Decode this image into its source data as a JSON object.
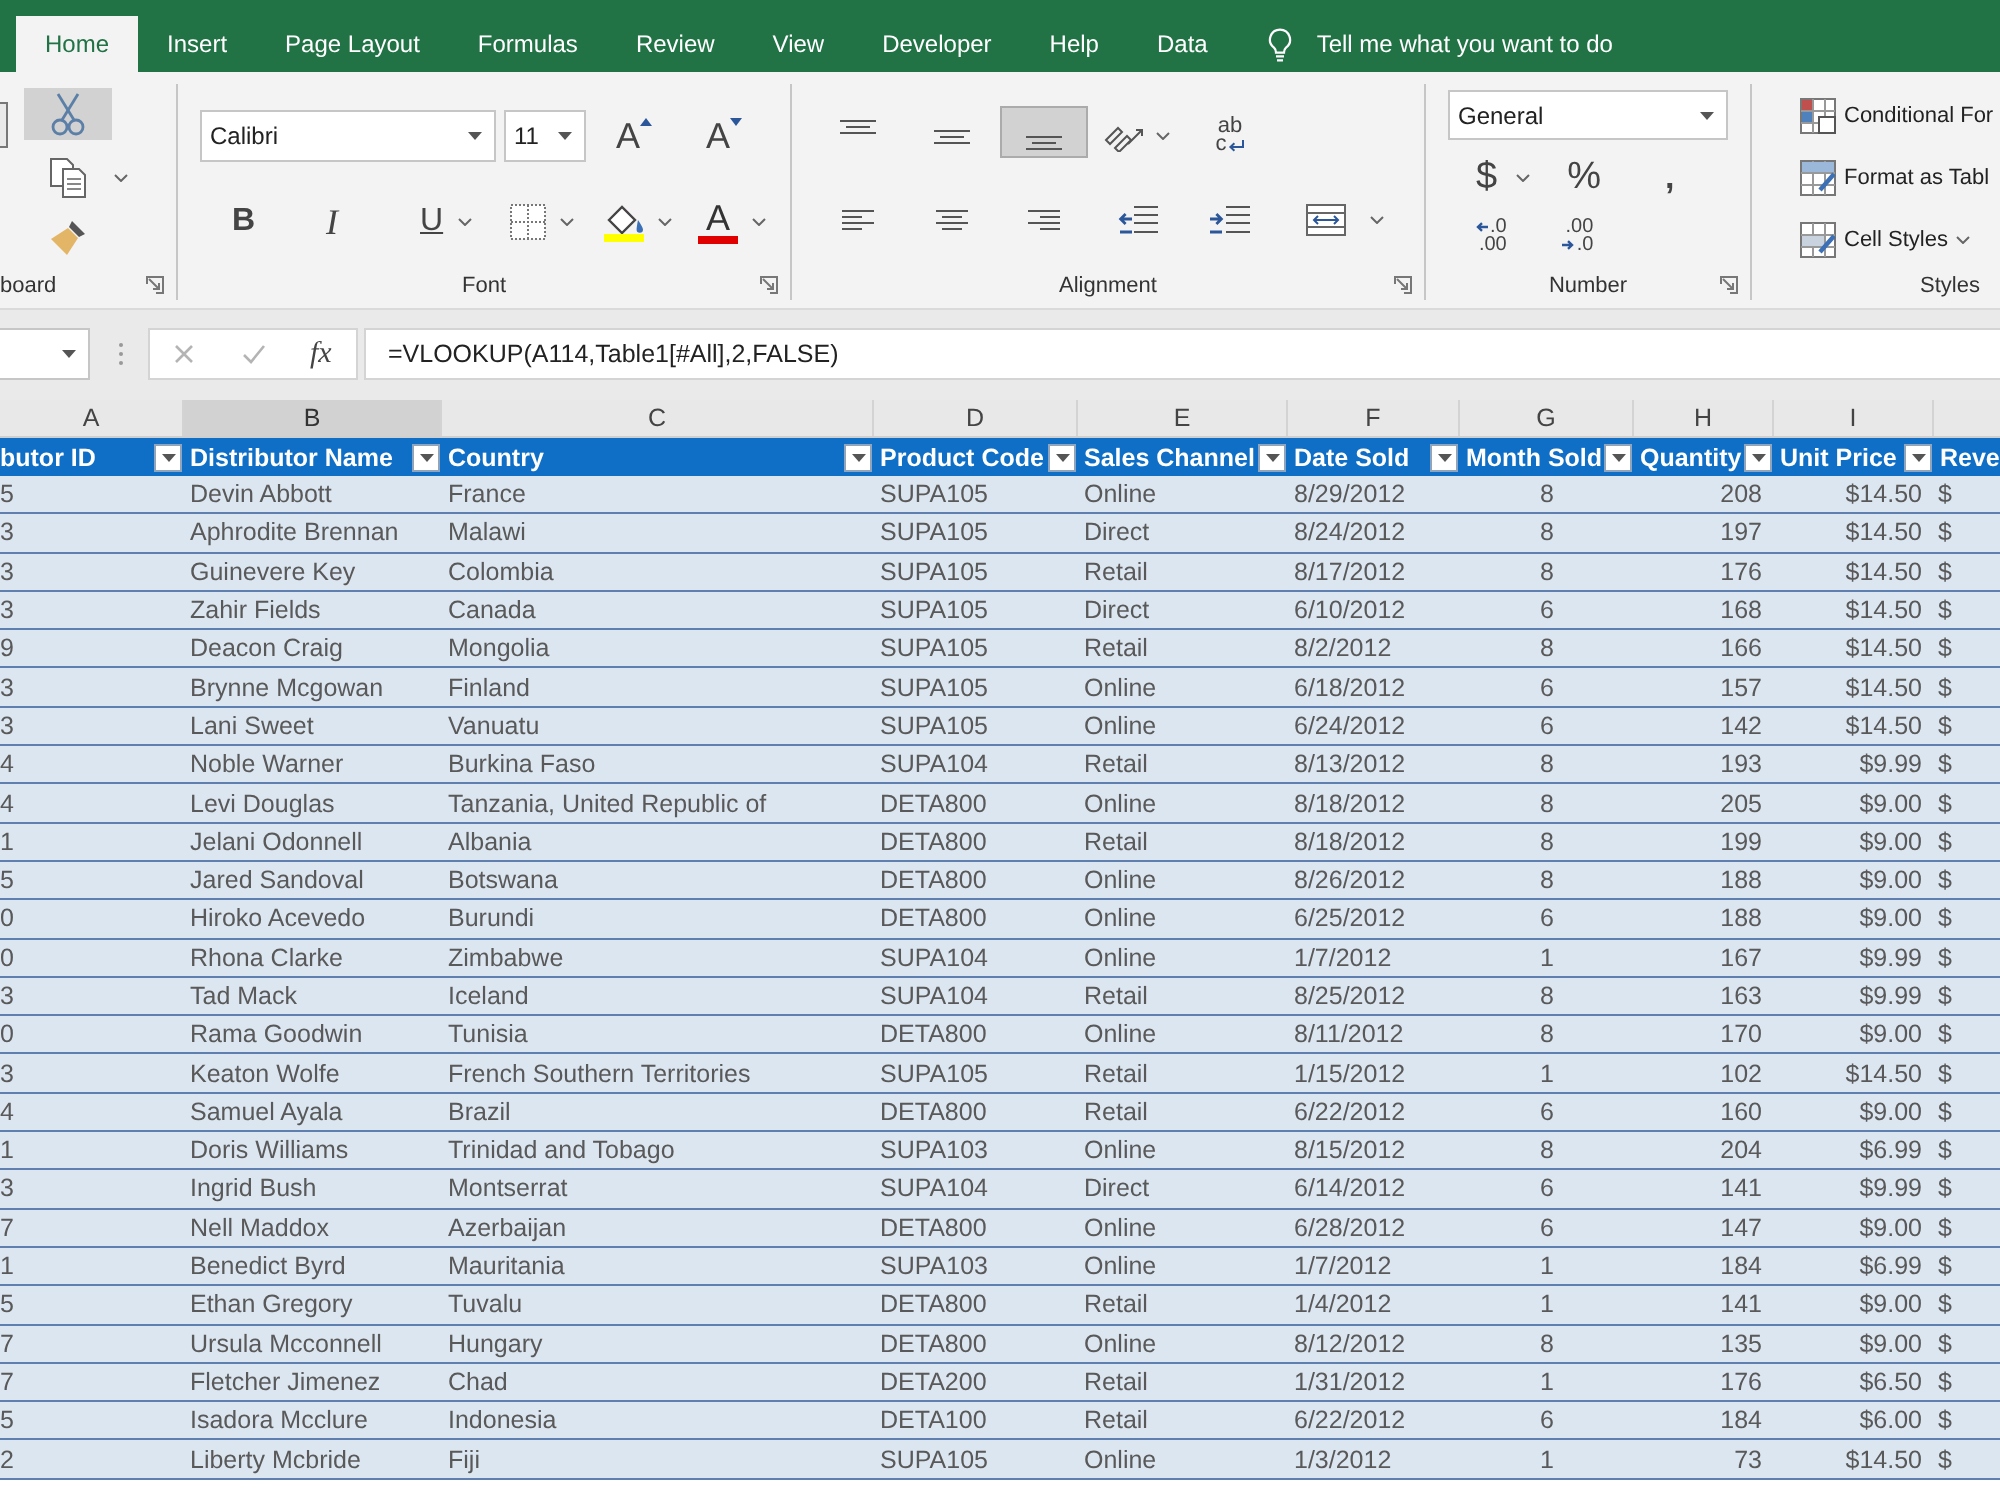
{
  "ribbon_tabs": [
    {
      "label": "Home",
      "selected": true
    },
    {
      "label": "Insert",
      "selected": false
    },
    {
      "label": "Page Layout",
      "selected": false
    },
    {
      "label": "Formulas",
      "selected": false
    },
    {
      "label": "Review",
      "selected": false
    },
    {
      "label": "View",
      "selected": false
    },
    {
      "label": "Developer",
      "selected": false
    },
    {
      "label": "Help",
      "selected": false
    },
    {
      "label": "Data",
      "selected": false
    }
  ],
  "tell_me": {
    "placeholder": "Tell me what you want to do"
  },
  "clipboard": {
    "label": "board",
    "launcher": true,
    "tools": [
      {
        "kind": "cut",
        "selected": true,
        "menu": false
      },
      {
        "kind": "copy",
        "selected": false,
        "menu": true
      },
      {
        "kind": "painter",
        "selected": false,
        "menu": false
      }
    ]
  },
  "font": {
    "label": "Font",
    "launcher": true,
    "font_name": "Calibri",
    "font_size": "11",
    "size_tools": [
      {
        "kind": "grow",
        "label": "A"
      },
      {
        "kind": "shrink",
        "label": "A"
      }
    ],
    "tools": [
      {
        "kind": "bold",
        "label": "B",
        "menu": false
      },
      {
        "kind": "italic",
        "label": "I",
        "menu": false
      },
      {
        "kind": "underline",
        "label": "U",
        "menu": true
      },
      {
        "kind": "borders",
        "menu": true
      },
      {
        "kind": "fill",
        "menu": true,
        "color": "#ffff00"
      },
      {
        "kind": "font-color",
        "label": "A",
        "menu": true,
        "color": "#e00000"
      }
    ]
  },
  "alignment": {
    "label": "Alignment",
    "launcher": true,
    "top_tools": [
      {
        "kind": "top",
        "selected": false,
        "menu": false
      },
      {
        "kind": "middle",
        "selected": false,
        "menu": false
      },
      {
        "kind": "bottom",
        "selected": true,
        "menu": false
      },
      {
        "kind": "orientation",
        "selected": false,
        "menu": true
      },
      {
        "kind": "wrap",
        "selected": false,
        "menu": false,
        "label": "ab",
        "sub_label": "c"
      }
    ],
    "bottom_tools": [
      {
        "kind": "left",
        "selected": false,
        "menu": false
      },
      {
        "kind": "center",
        "selected": false,
        "menu": false
      },
      {
        "kind": "right",
        "selected": false,
        "menu": false
      },
      {
        "kind": "decrease-indent",
        "selected": false,
        "menu": false
      },
      {
        "kind": "increase-indent",
        "selected": false,
        "menu": false
      },
      {
        "kind": "merge",
        "selected": false,
        "menu": true
      }
    ]
  },
  "number": {
    "label": "Number",
    "launcher": true,
    "format": "General",
    "tools": [
      {
        "kind": "currency",
        "label": "$",
        "menu": true
      },
      {
        "kind": "percent",
        "label": "%",
        "menu": false
      },
      {
        "kind": "comma",
        "label": ",",
        "menu": false
      }
    ],
    "decimal_tools": [
      {
        "kind": "increase",
        "top": ".0",
        "bottom": ".00"
      },
      {
        "kind": "decrease",
        "top": ".00",
        "bottom": ".0"
      }
    ]
  },
  "styles": {
    "label": "Styles",
    "launcher": false,
    "items": [
      {
        "kind": "conditional",
        "label": "Conditional For"
      },
      {
        "kind": "table",
        "label": "Format as Tabl"
      },
      {
        "kind": "cell-styles",
        "label": "Cell Styles",
        "menu": true
      }
    ]
  },
  "formula_bar": {
    "buttons": [
      {
        "kind": "cancel",
        "disabled": true
      },
      {
        "kind": "enter",
        "disabled": true
      }
    ],
    "function_label": "fx",
    "formula": "=VLOOKUP(A114,Table1[#All],2,FALSE)"
  },
  "column_letters": [
    {
      "label": "A",
      "selected": false
    },
    {
      "label": "B",
      "selected": true
    },
    {
      "label": "C",
      "selected": false
    },
    {
      "label": "D",
      "selected": false
    },
    {
      "label": "E",
      "selected": false
    },
    {
      "label": "F",
      "selected": false
    },
    {
      "label": "G",
      "selected": false
    },
    {
      "label": "H",
      "selected": false
    },
    {
      "label": "I",
      "selected": false
    }
  ],
  "table": {
    "columns": [
      {
        "label": "butor ID",
        "filter": true
      },
      {
        "label": "Distributor Name",
        "filter": true
      },
      {
        "label": "Country",
        "filter": true
      },
      {
        "label": "Product Code",
        "filter": true
      },
      {
        "label": "Sales Channel",
        "filter": true
      },
      {
        "label": "Date Sold",
        "filter": true
      },
      {
        "label": "Month Sold",
        "filter": true
      },
      {
        "label": "Quantity",
        "filter": true
      },
      {
        "label": "Unit Price",
        "filter": true
      },
      {
        "label": "Reve"
      }
    ],
    "rows": [
      [
        "5",
        "Devin Abbott",
        "France",
        "SUPA105",
        "Online",
        "8/29/2012",
        "8",
        "208",
        "$14.50",
        "$"
      ],
      [
        "3",
        "Aphrodite Brennan",
        "Malawi",
        "SUPA105",
        "Direct",
        "8/24/2012",
        "8",
        "197",
        "$14.50",
        "$"
      ],
      [
        "3",
        "Guinevere Key",
        "Colombia",
        "SUPA105",
        "Retail",
        "8/17/2012",
        "8",
        "176",
        "$14.50",
        "$"
      ],
      [
        "3",
        "Zahir Fields",
        "Canada",
        "SUPA105",
        "Direct",
        "6/10/2012",
        "6",
        "168",
        "$14.50",
        "$"
      ],
      [
        "9",
        "Deacon Craig",
        "Mongolia",
        "SUPA105",
        "Retail",
        "8/2/2012",
        "8",
        "166",
        "$14.50",
        "$"
      ],
      [
        "3",
        "Brynne Mcgowan",
        "Finland",
        "SUPA105",
        "Online",
        "6/18/2012",
        "6",
        "157",
        "$14.50",
        "$"
      ],
      [
        "3",
        "Lani Sweet",
        "Vanuatu",
        "SUPA105",
        "Online",
        "6/24/2012",
        "6",
        "142",
        "$14.50",
        "$"
      ],
      [
        "4",
        "Noble Warner",
        "Burkina Faso",
        "SUPA104",
        "Retail",
        "8/13/2012",
        "8",
        "193",
        "$9.99",
        "$"
      ],
      [
        "4",
        "Levi Douglas",
        "Tanzania, United Republic of",
        "DETA800",
        "Online",
        "8/18/2012",
        "8",
        "205",
        "$9.00",
        "$"
      ],
      [
        "1",
        "Jelani Odonnell",
        "Albania",
        "DETA800",
        "Retail",
        "8/18/2012",
        "8",
        "199",
        "$9.00",
        "$"
      ],
      [
        "5",
        "Jared Sandoval",
        "Botswana",
        "DETA800",
        "Online",
        "8/26/2012",
        "8",
        "188",
        "$9.00",
        "$"
      ],
      [
        "0",
        "Hiroko Acevedo",
        "Burundi",
        "DETA800",
        "Online",
        "6/25/2012",
        "6",
        "188",
        "$9.00",
        "$"
      ],
      [
        "0",
        "Rhona Clarke",
        "Zimbabwe",
        "SUPA104",
        "Online",
        "1/7/2012",
        "1",
        "167",
        "$9.99",
        "$"
      ],
      [
        "3",
        "Tad Mack",
        "Iceland",
        "SUPA104",
        "Retail",
        "8/25/2012",
        "8",
        "163",
        "$9.99",
        "$"
      ],
      [
        "0",
        "Rama Goodwin",
        "Tunisia",
        "DETA800",
        "Online",
        "8/11/2012",
        "8",
        "170",
        "$9.00",
        "$"
      ],
      [
        "3",
        "Keaton Wolfe",
        "French Southern Territories",
        "SUPA105",
        "Retail",
        "1/15/2012",
        "1",
        "102",
        "$14.50",
        "$"
      ],
      [
        "4",
        "Samuel Ayala",
        "Brazil",
        "DETA800",
        "Retail",
        "6/22/2012",
        "6",
        "160",
        "$9.00",
        "$"
      ],
      [
        "1",
        "Doris Williams",
        "Trinidad and Tobago",
        "SUPA103",
        "Online",
        "8/15/2012",
        "8",
        "204",
        "$6.99",
        "$"
      ],
      [
        "3",
        "Ingrid Bush",
        "Montserrat",
        "SUPA104",
        "Direct",
        "6/14/2012",
        "6",
        "141",
        "$9.99",
        "$"
      ],
      [
        "7",
        "Nell Maddox",
        "Azerbaijan",
        "DETA800",
        "Online",
        "6/28/2012",
        "6",
        "147",
        "$9.00",
        "$"
      ],
      [
        "1",
        "Benedict Byrd",
        "Mauritania",
        "SUPA103",
        "Online",
        "1/7/2012",
        "1",
        "184",
        "$6.99",
        "$"
      ],
      [
        "5",
        "Ethan Gregory",
        "Tuvalu",
        "DETA800",
        "Retail",
        "1/4/2012",
        "1",
        "141",
        "$9.00",
        "$"
      ],
      [
        "7",
        "Ursula Mcconnell",
        "Hungary",
        "DETA800",
        "Online",
        "8/12/2012",
        "8",
        "135",
        "$9.00",
        "$"
      ],
      [
        "7",
        "Fletcher Jimenez",
        "Chad",
        "DETA200",
        "Retail",
        "1/31/2012",
        "1",
        "176",
        "$6.50",
        "$"
      ],
      [
        "5",
        "Isadora Mcclure",
        "Indonesia",
        "DETA100",
        "Retail",
        "6/22/2012",
        "6",
        "184",
        "$6.00",
        "$"
      ],
      [
        "2",
        "Liberty Mcbride",
        "Fiji",
        "SUPA105",
        "Online",
        "1/3/2012",
        "1",
        "73",
        "$14.50",
        "$"
      ]
    ]
  }
}
